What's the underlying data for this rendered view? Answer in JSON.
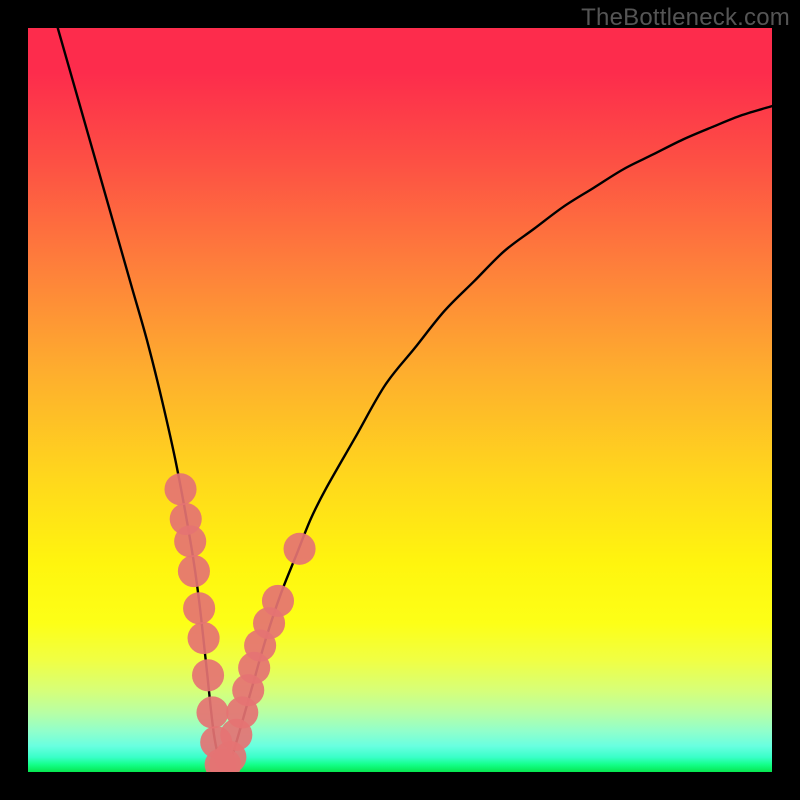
{
  "watermark": "TheBottleneck.com",
  "chart_data": {
    "type": "line",
    "title": "",
    "xlabel": "",
    "ylabel": "",
    "xlim": [
      0,
      100
    ],
    "ylim": [
      0,
      100
    ],
    "series": [
      {
        "name": "bottleneck-curve",
        "x": [
          4,
          6,
          8,
          10,
          12,
          14,
          16,
          18,
          20,
          22,
          23,
          24,
          25,
          26,
          27,
          28,
          30,
          32,
          34,
          36,
          38,
          40,
          44,
          48,
          52,
          56,
          60,
          64,
          68,
          72,
          76,
          80,
          84,
          88,
          92,
          96,
          100
        ],
        "values": [
          100,
          93,
          86,
          79,
          72,
          65,
          58,
          50,
          41,
          30,
          23,
          14,
          5,
          1,
          1,
          4,
          11,
          18,
          24,
          29,
          34,
          38,
          45,
          52,
          57,
          62,
          66,
          70,
          73,
          76,
          78.5,
          81,
          83,
          85,
          86.7,
          88.3,
          89.5
        ]
      }
    ],
    "markers": {
      "name": "highlight-dots",
      "color": "#e57373",
      "points": [
        {
          "x": 20.5,
          "y": 38,
          "r": 1.5
        },
        {
          "x": 21.2,
          "y": 34,
          "r": 1.5
        },
        {
          "x": 21.8,
          "y": 31,
          "r": 1.5
        },
        {
          "x": 22.3,
          "y": 27,
          "r": 1.5
        },
        {
          "x": 23.0,
          "y": 22,
          "r": 1.5
        },
        {
          "x": 23.6,
          "y": 18,
          "r": 1.5
        },
        {
          "x": 24.2,
          "y": 13,
          "r": 1.5
        },
        {
          "x": 24.8,
          "y": 8,
          "r": 1.5
        },
        {
          "x": 25.3,
          "y": 4,
          "r": 1.5
        },
        {
          "x": 25.9,
          "y": 1,
          "r": 1.5
        },
        {
          "x": 26.5,
          "y": 1,
          "r": 1.5
        },
        {
          "x": 27.2,
          "y": 2,
          "r": 1.5
        },
        {
          "x": 28.0,
          "y": 5,
          "r": 1.5
        },
        {
          "x": 28.8,
          "y": 8,
          "r": 1.5
        },
        {
          "x": 29.6,
          "y": 11,
          "r": 1.5
        },
        {
          "x": 30.4,
          "y": 14,
          "r": 1.5
        },
        {
          "x": 31.2,
          "y": 17,
          "r": 1.5
        },
        {
          "x": 32.4,
          "y": 20,
          "r": 1.5
        },
        {
          "x": 33.6,
          "y": 23,
          "r": 1.5
        },
        {
          "x": 36.5,
          "y": 30,
          "r": 1.5
        }
      ]
    }
  }
}
